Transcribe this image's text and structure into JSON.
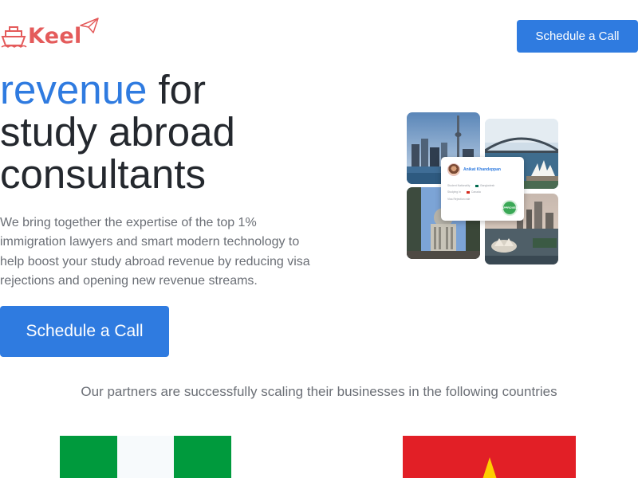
{
  "header": {
    "logo_text": "Keel",
    "cta_label": "Schedule a Call"
  },
  "hero": {
    "headline_accent": "revenue",
    "headline_rest": " for",
    "headline_line2": "study abroad",
    "headline_line3": "consultants",
    "description": "We bring together the expertise of the top 1% immigration lawyers and smart modern technology to help boost your study abroad revenue by reducing visa rejections and opening new revenue streams.",
    "cta_label": "Schedule a Call"
  },
  "collage": {
    "tiles": [
      "toronto-skyline",
      "sydney-harbour",
      "london-st-pauls",
      "singapore-marina"
    ],
    "card": {
      "name": "Anikat Khandeppan",
      "row1": "Student Nationality",
      "row1_value": "Bangladesh",
      "row2": "Studying In",
      "row2_value": "Canada",
      "row3": "Visa Rejection rate",
      "seal_text": "APPROVED"
    }
  },
  "partners": {
    "text": "Our partners are successfully scaling their businesses in the following countries",
    "flags": [
      "nigeria-flag",
      "vietnam-flag"
    ]
  },
  "colors": {
    "accent": "#2f7be0",
    "brand_red": "#e45b5b",
    "nigeria_green": "#009a3d",
    "vietnam_red": "#e21f26",
    "vietnam_star": "#ffcd00"
  }
}
